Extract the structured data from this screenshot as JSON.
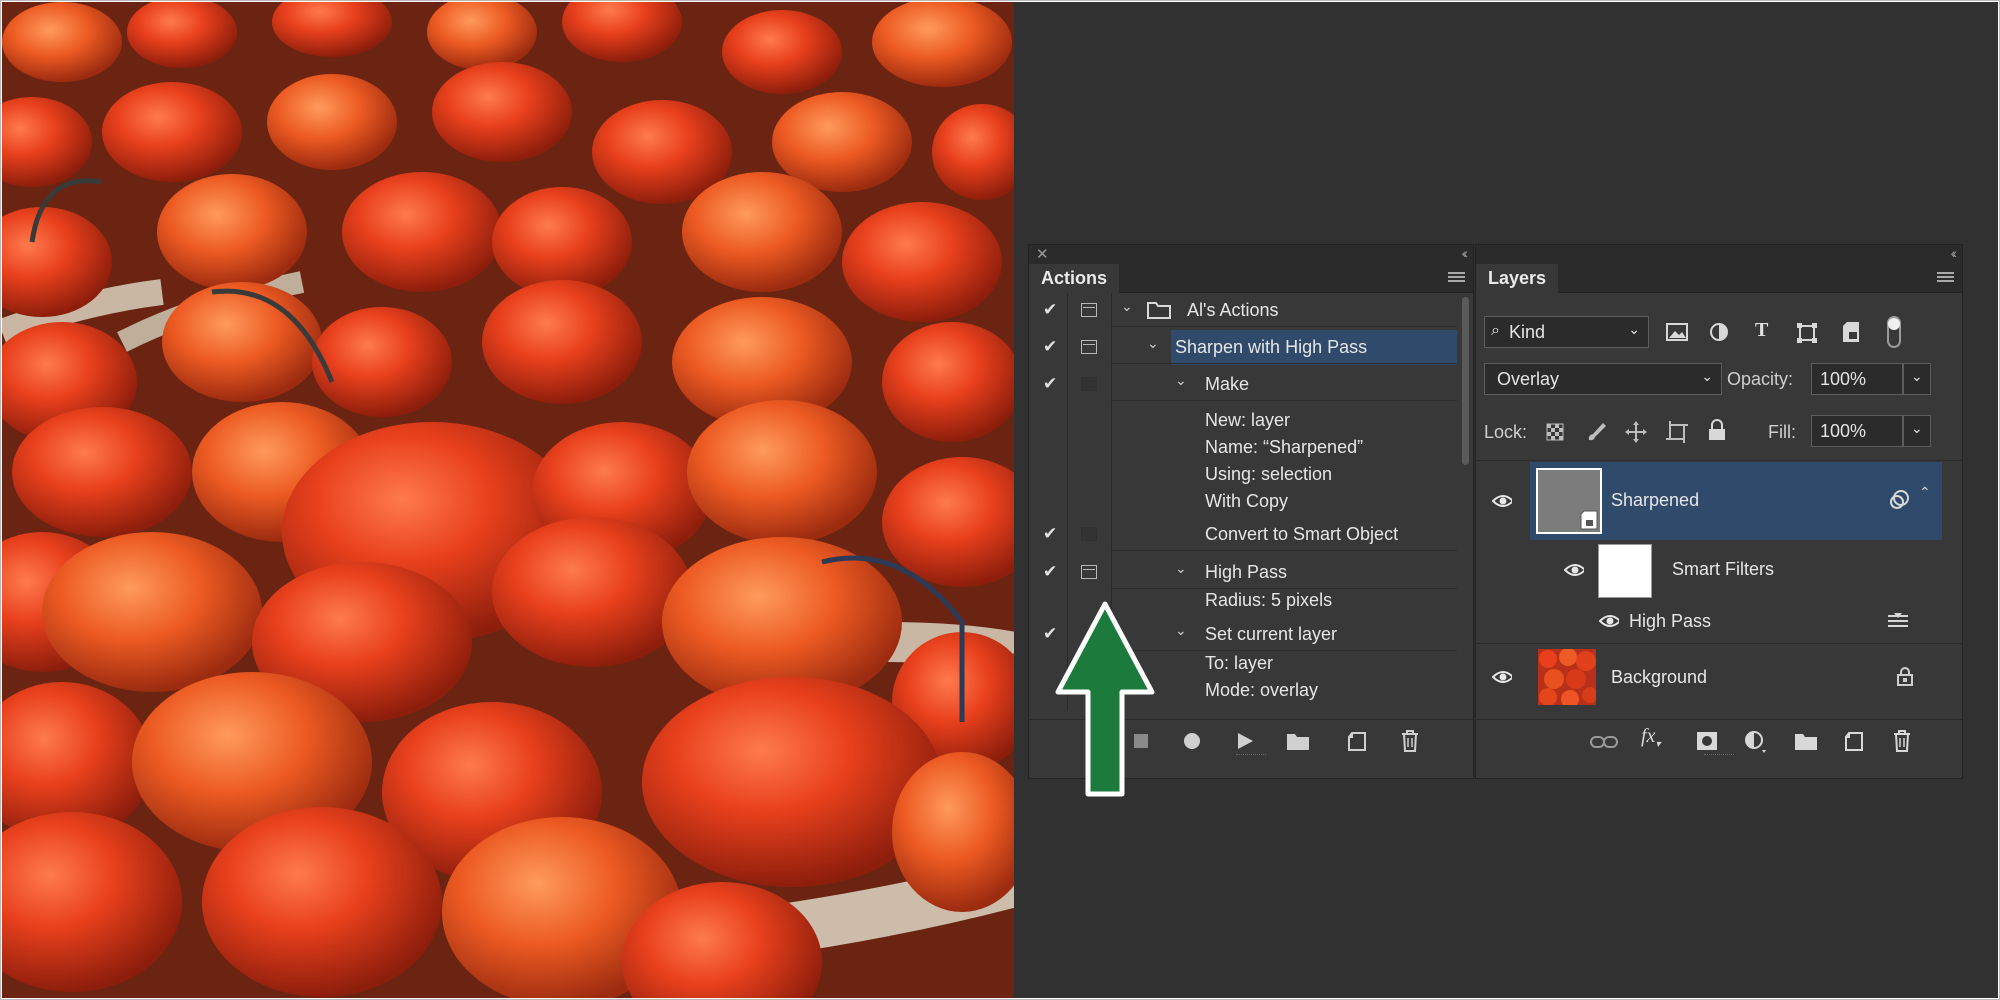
{
  "actions_panel": {
    "tab": "Actions",
    "rows": [
      {
        "check": "✔",
        "dialog": "dialog",
        "label": "Al's Actions",
        "expanded": true
      },
      {
        "check": "✔",
        "dialog": "dialog",
        "label": "Sharpen with High Pass",
        "expanded": true,
        "selected": true
      },
      {
        "check": "✔",
        "dialog": "empty",
        "label": "Make",
        "expanded": true
      },
      {
        "label": "New: layer"
      },
      {
        "label": "Name:  “Sharpened”"
      },
      {
        "label": "Using: selection"
      },
      {
        "label": "With Copy"
      },
      {
        "check": "✔",
        "dialog": "empty",
        "label": "Convert to Smart Object"
      },
      {
        "check": "✔",
        "dialog": "dialog",
        "label": "High Pass",
        "expanded": true
      },
      {
        "label": "Radius: 5 pixels"
      },
      {
        "check": "✔",
        "label": "Set current layer",
        "expanded": true
      },
      {
        "label": "To: layer"
      },
      {
        "label": "Mode: overlay"
      }
    ],
    "bottom_icons": [
      "stop-icon",
      "record-icon",
      "play-icon",
      "folder-icon",
      "new-action-icon",
      "trash-icon"
    ]
  },
  "layers_panel": {
    "tab": "Layers",
    "filter": {
      "label": "Kind",
      "icons": [
        "image-filter-icon",
        "adjustment-filter-icon",
        "type-filter-icon",
        "shape-filter-icon",
        "smart-object-filter-icon",
        "filter-toggle-icon"
      ]
    },
    "blend_mode": "Overlay",
    "opacity_label": "Opacity:",
    "opacity_value": "100%",
    "lock_label": "Lock:",
    "fill_label": "Fill:",
    "fill_value": "100%",
    "layers": [
      {
        "name": "Sharpened",
        "selected": true
      },
      {
        "name": "Smart Filters"
      },
      {
        "name": "High Pass"
      },
      {
        "name": "Background"
      }
    ],
    "bottom_icons": [
      "link-icon",
      "fx-icon",
      "mask-icon",
      "adjustment-icon",
      "group-folder-icon",
      "new-layer-icon",
      "trash-icon"
    ]
  },
  "colors": {
    "selection": "#2f4a6b",
    "arrow": "#1c7a3c",
    "panel": "#383838",
    "workspace": "#313131"
  }
}
